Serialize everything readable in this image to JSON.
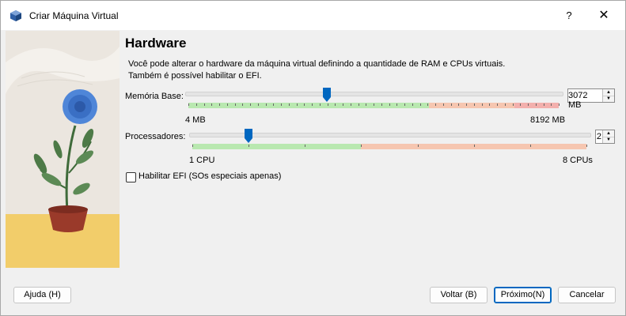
{
  "window": {
    "title": "Criar Máquina Virtual",
    "help_label": "?",
    "close_label": "✕"
  },
  "page": {
    "heading": "Hardware",
    "description": "Você pode alterar o hardware da máquina virtual definindo a quantidade de RAM e CPUs virtuais. Também é possível habilitar o EFI."
  },
  "memory": {
    "label": "Memória Base:",
    "value": 3072,
    "value_text": "3072 MB",
    "min": 4,
    "max": 8192,
    "min_label": "4 MB",
    "max_label": "8192 MB",
    "green_until_fraction": 0.65,
    "red_from_fraction": 0.88
  },
  "cpu": {
    "label": "Processadores:",
    "value": 2,
    "value_text": "2",
    "min": 1,
    "max": 8,
    "min_label": "1 CPU",
    "max_label": "8 CPUs"
  },
  "efi": {
    "label": "Habilitar EFI (SOs especiais apenas)",
    "checked": false
  },
  "buttons": {
    "help": "Ajuda (H)",
    "back": "Voltar (B)",
    "next": "Próximo(N)",
    "cancel": "Cancelar"
  },
  "colors": {
    "accent": "#0067c0",
    "ok_zone": "#b9e8b0",
    "warn_zone": "#f6c6b0",
    "bad_zone": "#f3b0ad",
    "illustration_bg": "#ebe6df",
    "illustration_floor": "#f2cd6a"
  }
}
